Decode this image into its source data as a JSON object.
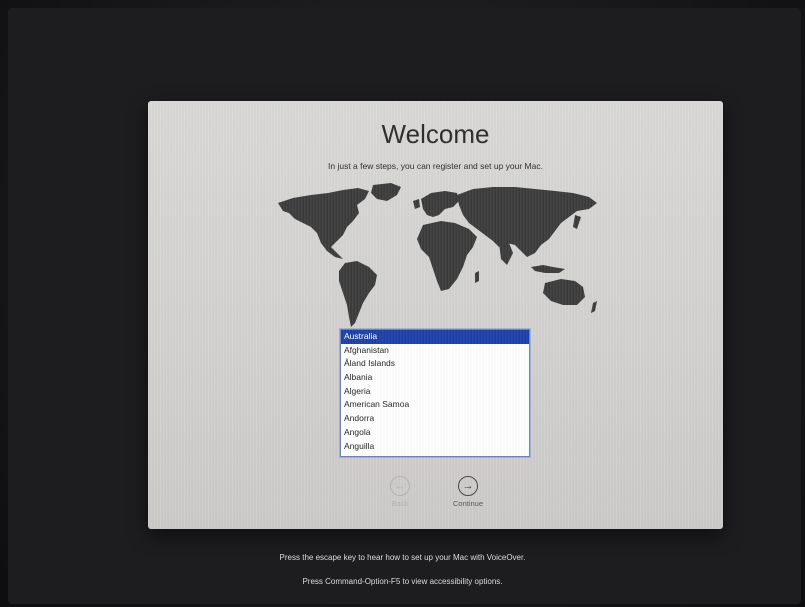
{
  "window": {
    "title": "Welcome",
    "subtitle": "In just a few steps, you can register and set up your Mac."
  },
  "country_list": {
    "selected": "Australia",
    "items": [
      "Australia",
      "Afghanistan",
      "Åland Islands",
      "Albania",
      "Algeria",
      "American Samoa",
      "Andorra",
      "Angola",
      "Anguilla"
    ]
  },
  "buttons": {
    "back_label": "Back",
    "continue_label": "Continue",
    "back_icon": "left-arrow-circle",
    "continue_icon": "right-arrow-circle"
  },
  "footer": {
    "voiceover_hint": "Press the escape key to hear how to set up your Mac with VoiceOver.",
    "accessibility_hint": "Press Command-Option-F5 to view accessibility options."
  },
  "colors": {
    "selection": "#1a3fa8",
    "map": "#3a3a3a"
  }
}
